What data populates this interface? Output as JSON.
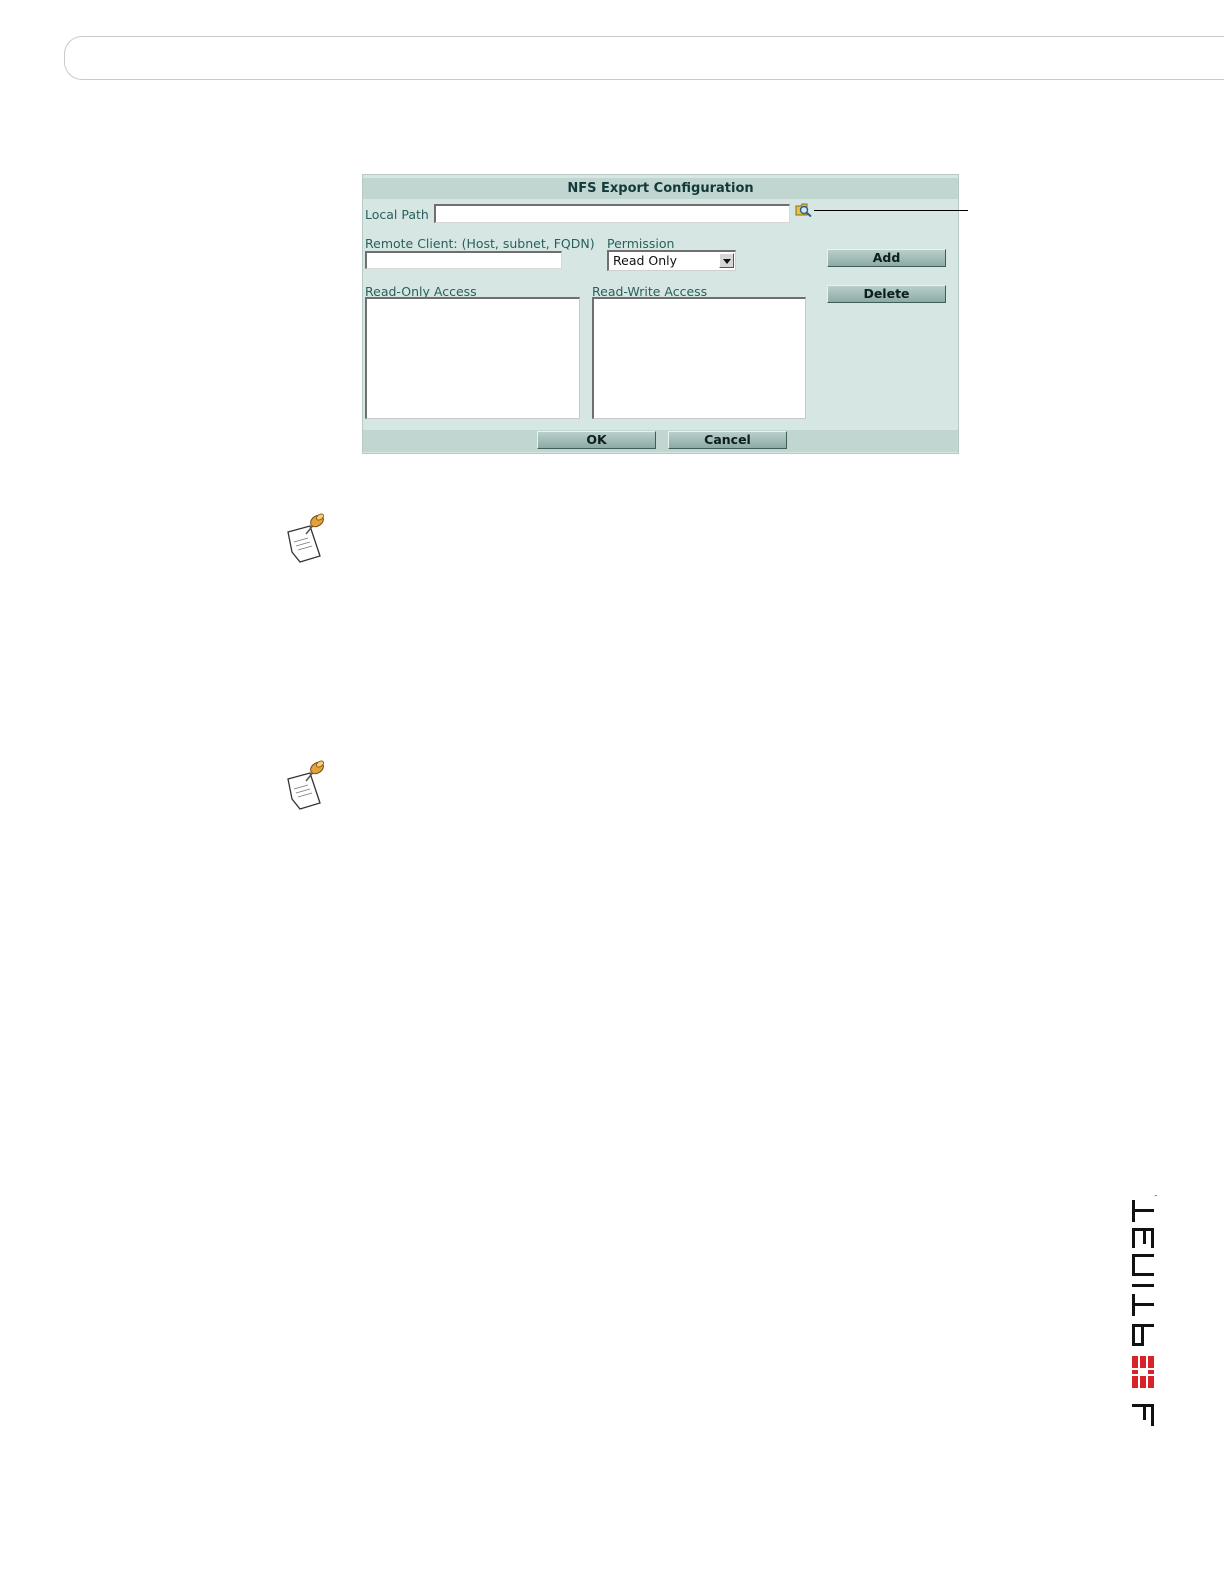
{
  "dialog": {
    "title": "NFS Export Configuration",
    "local_path": {
      "label": "Local Path",
      "value": ""
    },
    "remote_client": {
      "label": "Remote Client: (Host, subnet, FQDN)",
      "value": ""
    },
    "permission": {
      "label": "Permission",
      "selected": "Read Only"
    },
    "read_only_access": {
      "label": "Read-Only Access",
      "items": []
    },
    "read_write_access": {
      "label": "Read-Write Access",
      "items": []
    },
    "buttons": {
      "add": "Add",
      "delete": "Delete",
      "ok": "OK",
      "cancel": "Cancel"
    },
    "icons": {
      "browse": "folder-search-icon"
    }
  },
  "logo": {
    "text": "FORTINET"
  },
  "colors": {
    "dialog_bg": "#d6e6e3",
    "title_bar": "#c1d5d1",
    "label_text": "#2a5f5d",
    "logo_red": "#d8232a"
  }
}
